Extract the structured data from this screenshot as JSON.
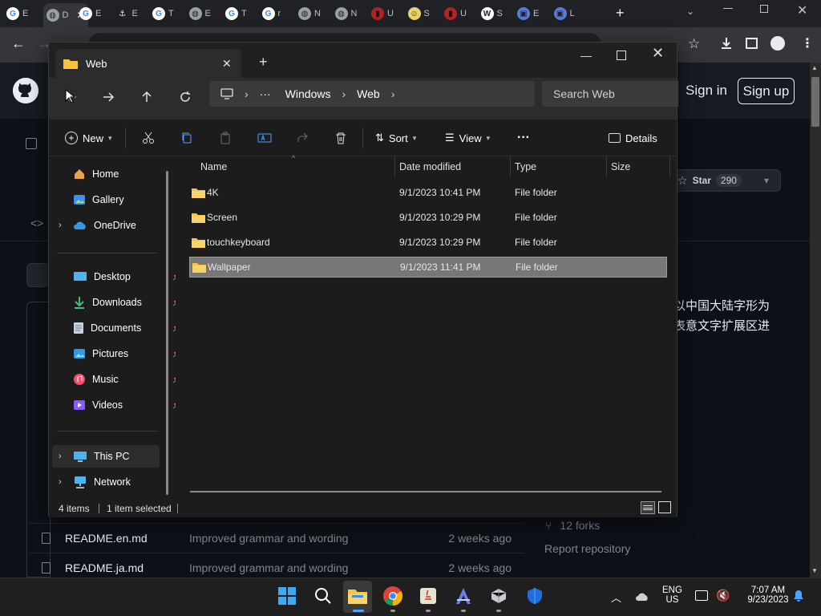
{
  "browser": {
    "tabs": [
      {
        "letter": "E",
        "icon": "google-icon"
      },
      {
        "letter": "D",
        "icon": "globe-icon"
      },
      {
        "letter": "E",
        "icon": "google-icon"
      },
      {
        "letter": "E",
        "icon": "anchor-icon"
      },
      {
        "letter": "T",
        "icon": "google-icon"
      },
      {
        "letter": "E",
        "icon": "globe-icon"
      },
      {
        "letter": "T",
        "icon": "google-icon"
      },
      {
        "letter": "r",
        "icon": "google-icon"
      },
      {
        "letter": "N",
        "icon": "globe-icon"
      },
      {
        "letter": "N",
        "icon": "globe-icon"
      },
      {
        "letter": "U",
        "icon": "red-site-icon"
      },
      {
        "letter": "S",
        "icon": "emoji-site-icon"
      },
      {
        "letter": "U",
        "icon": "red-site-icon"
      },
      {
        "letter": "S",
        "icon": "wikipedia-icon"
      },
      {
        "letter": "E",
        "icon": "site-icon"
      },
      {
        "letter": "L",
        "icon": "site-icon"
      }
    ]
  },
  "github": {
    "sign_in": "Sign in",
    "sign_up": "Sign up",
    "star_label": "Star",
    "star_count": "290",
    "description_line1": "以中国大陆字形为",
    "description_line2": "表意文字扩展区进",
    "files": [
      {
        "name": "README.en.md",
        "commit": "Improved grammar and wording",
        "time": "2 weeks ago"
      },
      {
        "name": "README.ja.md",
        "commit": "Improved grammar and wording",
        "time": "2 weeks ago"
      }
    ],
    "forks": "12 forks",
    "report": "Report repository"
  },
  "explorer": {
    "tab_title": "Web",
    "address": {
      "ellipsis": "···",
      "crumbs": [
        "Windows",
        "Web"
      ]
    },
    "search_placeholder": "Search Web",
    "commands": {
      "new": "New",
      "sort": "Sort",
      "view": "View",
      "more": "···",
      "details": "Details"
    },
    "nav": {
      "home": "Home",
      "gallery": "Gallery",
      "onedrive": "OneDrive",
      "desktop": "Desktop",
      "downloads": "Downloads",
      "documents": "Documents",
      "pictures": "Pictures",
      "music": "Music",
      "videos": "Videos",
      "this_pc": "This PC",
      "network": "Network"
    },
    "columns": {
      "name": "Name",
      "date": "Date modified",
      "type": "Type",
      "size": "Size"
    },
    "files": [
      {
        "name": "4K",
        "date": "9/1/2023 10:41 PM",
        "type": "File folder"
      },
      {
        "name": "Screen",
        "date": "9/1/2023 10:29 PM",
        "type": "File folder"
      },
      {
        "name": "touchkeyboard",
        "date": "9/1/2023 10:29 PM",
        "type": "File folder"
      },
      {
        "name": "Wallpaper",
        "date": "9/1/2023 11:41 PM",
        "type": "File folder"
      }
    ],
    "status": {
      "items": "4 items",
      "selected": "1 item selected"
    }
  },
  "taskbar": {
    "lang_line1": "ENG",
    "lang_line2": "US",
    "time": "7:07 AM",
    "date": "9/23/2023"
  }
}
